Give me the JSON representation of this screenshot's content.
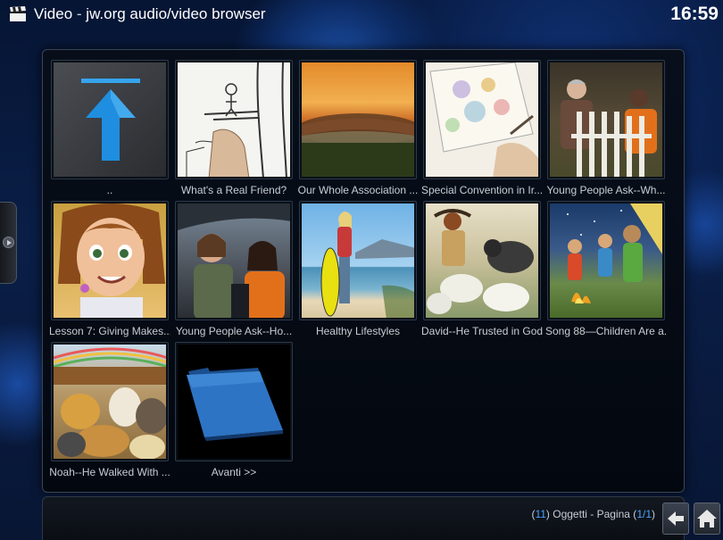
{
  "header": {
    "section": "Video",
    "separator": " - ",
    "subtitle": "jw.org audio/video browser",
    "clock": "16:59",
    "icon": "clapperboard-icon"
  },
  "items": [
    {
      "label": "..",
      "thumb": "up-arrow-icon"
    },
    {
      "label": "What's a Real Friend?",
      "thumb": "sketch-tree-drawing"
    },
    {
      "label": "Our Whole Association ...",
      "thumb": "stadium-sunset"
    },
    {
      "label": "Special Convention in Ir...",
      "thumb": "watercolor-drawing"
    },
    {
      "label": "Young People Ask--Wh...",
      "thumb": "two-men-by-fence"
    },
    {
      "label": "Lesson 7: Giving Makes...",
      "thumb": "cartoon-girl"
    },
    {
      "label": "Young People Ask--Ho...",
      "thumb": "women-in-car"
    },
    {
      "label": "Healthy Lifestyles",
      "thumb": "woman-with-surfboard"
    },
    {
      "label": "David--He Trusted in God",
      "thumb": "david-with-sheep"
    },
    {
      "label": "Song 88—Children Are a...",
      "thumb": "family-at-campfire"
    },
    {
      "label": "Noah--He Walked With ...",
      "thumb": "noah-ark-animals"
    },
    {
      "label": "Avanti >>",
      "thumb": "blue-folder-icon"
    }
  ],
  "footer": {
    "open_paren": "(",
    "count": "11",
    "count_close": ") Oggetti - Pagina (",
    "page": "1/1",
    "page_close": ")"
  },
  "colors": {
    "accent": "#4aa3ff",
    "background": "#0a1e47",
    "panel": "#05090f"
  }
}
